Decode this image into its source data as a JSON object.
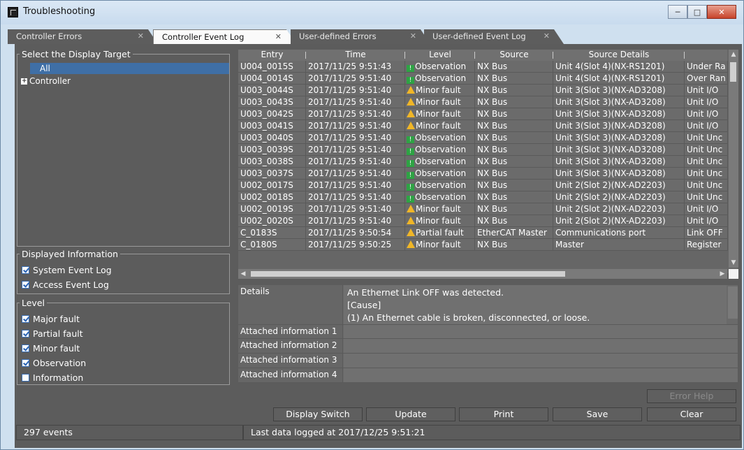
{
  "window": {
    "title": "Troubleshooting"
  },
  "tabs": [
    {
      "label": "Controller Errors"
    },
    {
      "label": "Controller Event Log"
    },
    {
      "label": "User-defined Errors"
    },
    {
      "label": "User-defined Event Log"
    }
  ],
  "display_target": {
    "title": "Select the Display Target",
    "items": [
      "All",
      "Controller"
    ]
  },
  "displayed_information": {
    "title": "Displayed Information",
    "options": [
      {
        "label": "System Event Log",
        "checked": true
      },
      {
        "label": "Access Event Log",
        "checked": true
      }
    ]
  },
  "level_filter": {
    "title": "Level",
    "options": [
      {
        "label": "Major fault",
        "checked": true
      },
      {
        "label": "Partial fault",
        "checked": true
      },
      {
        "label": "Minor fault",
        "checked": true
      },
      {
        "label": "Observation",
        "checked": true
      },
      {
        "label": "Information",
        "checked": false
      }
    ]
  },
  "table": {
    "columns": [
      "Entry",
      "Time",
      "Level",
      "Source",
      "Source Details",
      ""
    ],
    "rows": [
      [
        "U004_0015S",
        "2017/11/25 9:51:43",
        "Observation",
        "NX Bus",
        "Unit 4(Slot 4)(NX-RS1201)",
        "Under Ra"
      ],
      [
        "U004_0014S",
        "2017/11/25 9:51:40",
        "Observation",
        "NX Bus",
        "Unit 4(Slot 4)(NX-RS1201)",
        "Over Ran"
      ],
      [
        "U003_0044S",
        "2017/11/25 9:51:40",
        "Minor fault",
        "NX Bus",
        "Unit 3(Slot 3)(NX-AD3208)",
        "Unit I/O"
      ],
      [
        "U003_0043S",
        "2017/11/25 9:51:40",
        "Minor fault",
        "NX Bus",
        "Unit 3(Slot 3)(NX-AD3208)",
        "Unit I/O"
      ],
      [
        "U003_0042S",
        "2017/11/25 9:51:40",
        "Minor fault",
        "NX Bus",
        "Unit 3(Slot 3)(NX-AD3208)",
        "Unit I/O"
      ],
      [
        "U003_0041S",
        "2017/11/25 9:51:40",
        "Minor fault",
        "NX Bus",
        "Unit 3(Slot 3)(NX-AD3208)",
        "Unit I/O"
      ],
      [
        "U003_0040S",
        "2017/11/25 9:51:40",
        "Observation",
        "NX Bus",
        "Unit 3(Slot 3)(NX-AD3208)",
        "Unit Unc"
      ],
      [
        "U003_0039S",
        "2017/11/25 9:51:40",
        "Observation",
        "NX Bus",
        "Unit 3(Slot 3)(NX-AD3208)",
        "Unit Unc"
      ],
      [
        "U003_0038S",
        "2017/11/25 9:51:40",
        "Observation",
        "NX Bus",
        "Unit 3(Slot 3)(NX-AD3208)",
        "Unit Unc"
      ],
      [
        "U003_0037S",
        "2017/11/25 9:51:40",
        "Observation",
        "NX Bus",
        "Unit 3(Slot 3)(NX-AD3208)",
        "Unit Unc"
      ],
      [
        "U002_0017S",
        "2017/11/25 9:51:40",
        "Observation",
        "NX Bus",
        "Unit 2(Slot 2)(NX-AD2203)",
        "Unit Unc"
      ],
      [
        "U002_0018S",
        "2017/11/25 9:51:40",
        "Observation",
        "NX Bus",
        "Unit 2(Slot 2)(NX-AD2203)",
        "Unit Unc"
      ],
      [
        "U002_0019S",
        "2017/11/25 9:51:40",
        "Minor fault",
        "NX Bus",
        "Unit 2(Slot 2)(NX-AD2203)",
        "Unit I/O"
      ],
      [
        "U002_0020S",
        "2017/11/25 9:51:40",
        "Minor fault",
        "NX Bus",
        "Unit 2(Slot 2)(NX-AD2203)",
        "Unit I/O"
      ],
      [
        "C_0183S",
        "2017/11/25 9:50:54",
        "Partial fault",
        "EtherCAT Master",
        "Communications port",
        "Link OFF"
      ],
      [
        "C_0180S",
        "2017/11/25 9:50:25",
        "Minor fault",
        "NX Bus",
        "Master",
        "Register"
      ]
    ]
  },
  "details": {
    "label": "Details",
    "lines": [
      "An Ethernet Link OFF was detected.",
      "[Cause]",
      "(1) An Ethernet cable is broken, disconnected, or loose."
    ],
    "attached": [
      {
        "label": "Attached information 1",
        "value": ""
      },
      {
        "label": "Attached information 2",
        "value": ""
      },
      {
        "label": "Attached information 3",
        "value": ""
      },
      {
        "label": "Attached information 4",
        "value": ""
      }
    ]
  },
  "buttons": {
    "error_help": "Error Help",
    "display_switch": "Display Switch",
    "update": "Update",
    "print": "Print",
    "save": "Save",
    "clear": "Clear"
  },
  "status": {
    "count": "297 events",
    "last_logged": "Last data logged at 2017/12/25 9:51:21"
  },
  "colors": {
    "observation": "#2ea344",
    "warning": "#f0b627",
    "selection": "#3f6fa6"
  }
}
